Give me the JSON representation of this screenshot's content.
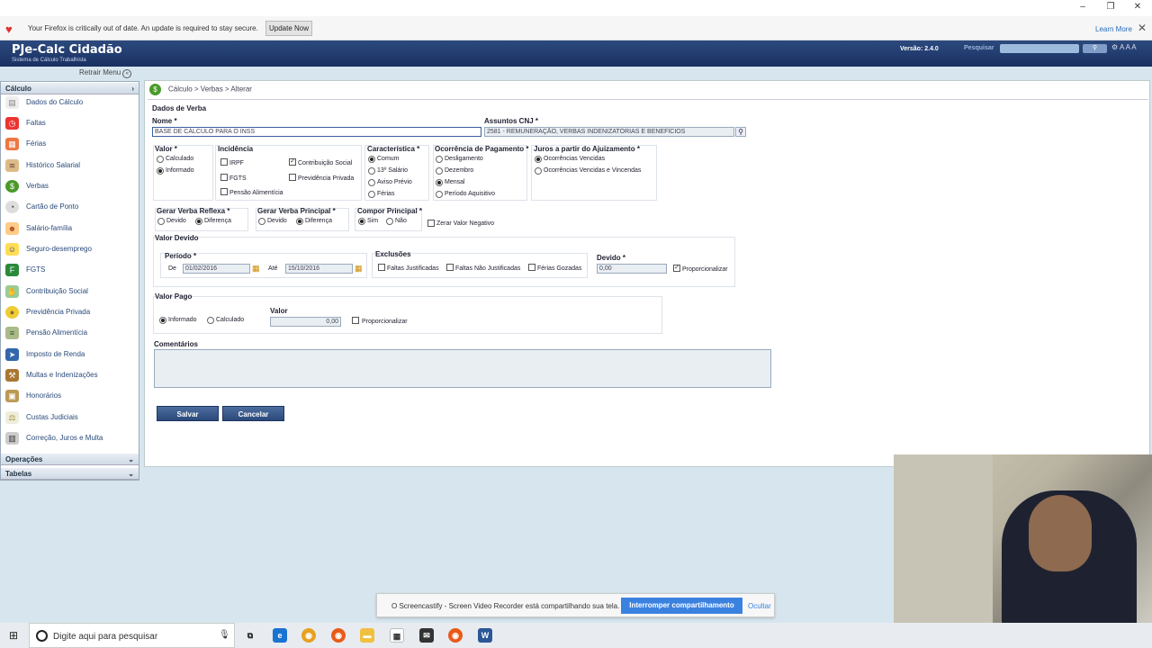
{
  "browser": {
    "notification": "Your Firefox is critically out of date. An update is required to stay secure.",
    "update_button": "Update Now",
    "learn_more": "Learn More"
  },
  "header": {
    "title": "PJe-Calc Cidadão",
    "subtitle": "Sistema de Cálculo Trabalhista",
    "version": "Versão: 2.4.0",
    "search_label": "Pesquisar"
  },
  "sidebar": {
    "retrair": "Retrair Menu",
    "section_calculo": "Cálculo",
    "items": [
      {
        "label": "Dados do Cálculo",
        "icon": "document-icon"
      },
      {
        "label": "Faltas",
        "icon": "clock-alarm-icon"
      },
      {
        "label": "Férias",
        "icon": "calendar-icon"
      },
      {
        "label": "Histórico Salarial",
        "icon": "money-stack-icon"
      },
      {
        "label": "Verbas",
        "icon": "dollar-coin-icon"
      },
      {
        "label": "Cartão de Ponto",
        "icon": "timer-icon"
      },
      {
        "label": "Salário-família",
        "icon": "family-icon"
      },
      {
        "label": "Seguro-desemprego",
        "icon": "person-icon"
      },
      {
        "label": "FGTS",
        "icon": "fgts-icon"
      },
      {
        "label": "Contribuição Social",
        "icon": "cash-hand-icon"
      },
      {
        "label": "Previdência Privada",
        "icon": "piggy-icon"
      },
      {
        "label": "Pensão Alimentícia",
        "icon": "bills-icon"
      },
      {
        "label": "Imposto de Renda",
        "icon": "tax-icon"
      },
      {
        "label": "Multas e Indenizações",
        "icon": "gavel-icon"
      },
      {
        "label": "Honorários",
        "icon": "briefcase-icon"
      },
      {
        "label": "Custas Judiciais",
        "icon": "scales-icon"
      },
      {
        "label": "Correção, Juros e Multa",
        "icon": "calculator-icon"
      }
    ],
    "section_operacoes": "Operações",
    "section_tabelas": "Tabelas"
  },
  "breadcrumb": "Cálculo > Verbas > Alterar",
  "form": {
    "section_title": "Dados de Verba",
    "nome_label": "Nome *",
    "nome_value": "BASE DE CÁLCULO PARA O INSS",
    "assuntos_label": "Assuntos CNJ *",
    "assuntos_value": "2581 - REMUNERAÇÃO, VERBAS INDENIZATÓRIAS E BENEFÍCIOS",
    "valor_label": "Valor *",
    "valor_opts": [
      "Calculado",
      "Informado"
    ],
    "incidencia_label": "Incidência",
    "incidencia_opts": [
      "IRPF",
      "Contribuição Social",
      "FGTS",
      "Previdência Privada",
      "Pensão Alimentícia"
    ],
    "caracteristica_label": "Característica *",
    "caracteristica_opts": [
      "Comum",
      "13º Salário",
      "Aviso Prévio",
      "Férias"
    ],
    "ocorrencia_label": "Ocorrência de Pagamento *",
    "ocorrencia_opts": [
      "Desligamento",
      "Dezembro",
      "Mensal",
      "Período Aquisitivo"
    ],
    "juros_label": "Juros a partir do Ajuizamento *",
    "juros_opts": [
      "Ocorrências Vencidas",
      "Ocorrências Vencidas e Vincendas"
    ],
    "gerar_reflexa_label": "Gerar Verba Reflexa *",
    "gerar_principal_label": "Gerar Verba Principal *",
    "devido": "Devido",
    "diferenca": "Diferença",
    "compor_label": "Compor Principal *",
    "sim": "Sim",
    "nao": "Não",
    "zerar": "Zerar Valor Negativo",
    "valor_devido_label": "Valor Devido",
    "periodo_label": "Período *",
    "de": "De",
    "de_value": "01/02/2016",
    "ate": "Até",
    "ate_value": "15/10/2016",
    "exclusoes_label": "Exclusões",
    "exclusoes_opts": [
      "Faltas Justificadas",
      "Faltas Não Justificadas",
      "Férias Gozadas"
    ],
    "devido_label": "Devido *",
    "devido_value": "0,00",
    "proporcionalizar": "Proporcionalizar",
    "valor_pago_label": "Valor Pago",
    "pago_opts": [
      "Informado",
      "Calculado"
    ],
    "valor_field_label": "Valor",
    "valor_field_value": "0,00",
    "comentarios_label": "Comentários",
    "salvar": "Salvar",
    "cancelar": "Cancelar"
  },
  "screencastify": {
    "message": "O Screencastify - Screen Video Recorder está compartilhando sua tela.",
    "stop_button": "Interromper compartilhamento",
    "hide": "Ocultar"
  },
  "taskbar": {
    "search_placeholder": "Digite aqui para pesquisar"
  }
}
